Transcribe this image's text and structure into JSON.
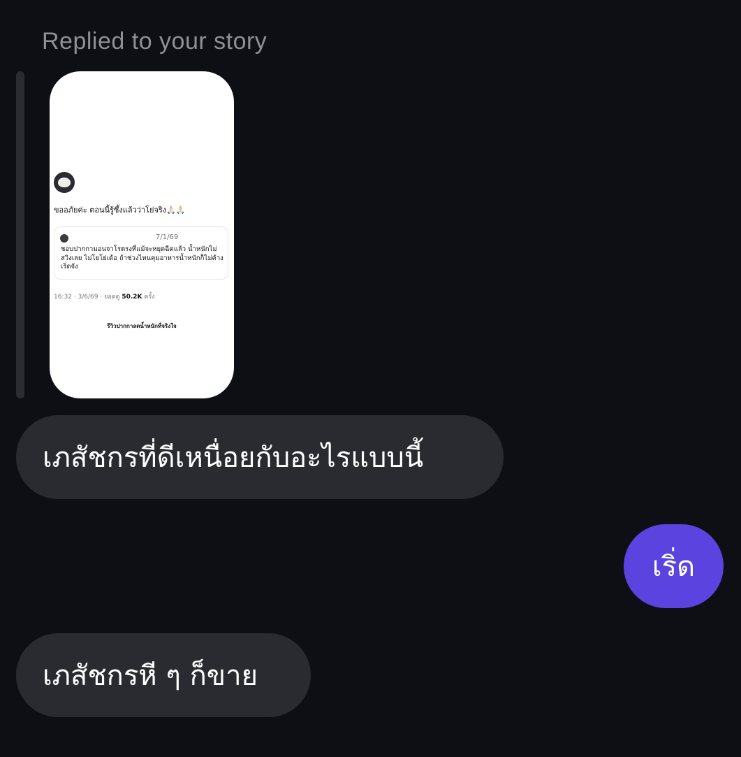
{
  "reply_header": {
    "label": "Replied to your story"
  },
  "story": {
    "post_text": "ขออภัยค่ะ ตอนนี้รู้ซึ้งแล้วว่าโย่จริง🙏🏻🙏🏻",
    "quote_date": "7/1/69",
    "quote_text": "ชอบปากกามอนจาโรตรงที่แม้จะหยุดฉีดแล้ว น้ำหนักไม่สวิงเลย ไม่โยโย่เด้อ ถ้าช่วงไหนคุมอาหารน้ำหนักก็ไม่ค้าง เริ่ดจัง",
    "meta_prefix": "16:32 · 3/6/69 · ยอดดู",
    "meta_views": "50.2K",
    "meta_suffix": "ครั้ง",
    "caption": "รีวิวปากกาลดน้ำหนักที่จริงใจ"
  },
  "messages": [
    {
      "from": "other",
      "text": "เภสัชกรที่ดีเหนื่อยกับอะไรแบบนี้"
    },
    {
      "from": "me",
      "text": "เริ่ด"
    },
    {
      "from": "other",
      "text": "เภสัชกรหี ๆ ก็ขาย"
    }
  ],
  "colors": {
    "background": "#0e0f14",
    "received_bubble": "#2a2b30",
    "sent_bubble": "#5b43e0"
  }
}
